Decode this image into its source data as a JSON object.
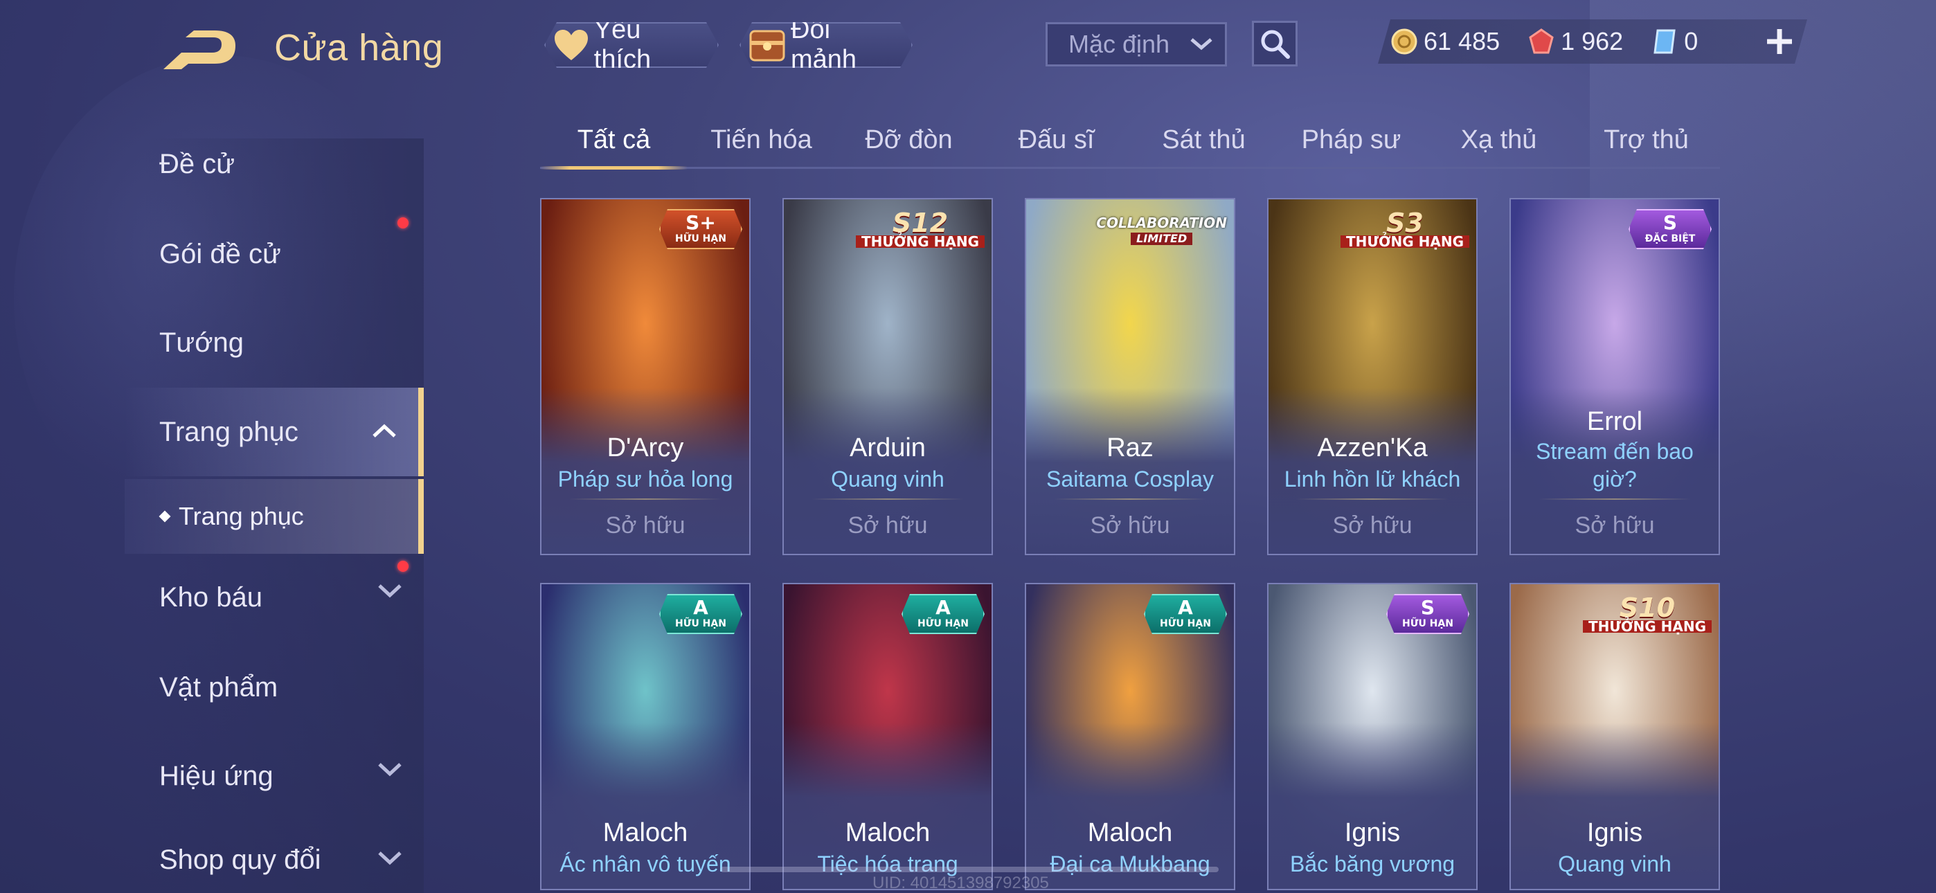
{
  "header": {
    "title": "Cửa hàng",
    "favorites_label": "Yêu thích",
    "shards_label": "Đổi mảnh",
    "sort_value": "Mặc định",
    "currencies": [
      {
        "icon": "gold-coin-icon",
        "value": "61 485"
      },
      {
        "icon": "red-gem-icon",
        "value": "1 962"
      },
      {
        "icon": "blue-voucher-icon",
        "value": "0"
      }
    ]
  },
  "sidebar": {
    "items": [
      {
        "label": "Đề cử"
      },
      {
        "label": "Gói đề cử"
      },
      {
        "label": "Tướng"
      },
      {
        "label": "Trang phục"
      },
      {
        "label": "Kho báu"
      },
      {
        "label": "Vật phẩm"
      },
      {
        "label": "Hiệu ứng"
      },
      {
        "label": "Shop quy đổi"
      }
    ],
    "sub_item": "Trang phục"
  },
  "tabs": [
    "Tất cả",
    "Tiến hóa",
    "Đỡ đòn",
    "Đấu sĩ",
    "Sát thủ",
    "Pháp sư",
    "Xạ thủ",
    "Trợ thủ"
  ],
  "cards": [
    {
      "hero": "D'Arcy",
      "skin": "Pháp sư hỏa long",
      "status": "Sở hữu",
      "badge_tier": "S+",
      "badge_sub": "HỮU HẠN",
      "art_a": "#f08a3a",
      "art_b": "#6b1e12"
    },
    {
      "hero": "Arduin",
      "skin": "Quang vinh",
      "status": "Sở hữu",
      "badge_tier": "S12",
      "badge_sub": "THƯỞNG HẠNG",
      "art_a": "#9fb3c8",
      "art_b": "#3a3b48"
    },
    {
      "hero": "Raz",
      "skin": "Saitama Cosplay",
      "status": "Sở hữu",
      "badge_tier": "COLLABORATION",
      "badge_sub": "LIMITED",
      "art_a": "#f2d64c",
      "art_b": "#8fa9c6"
    },
    {
      "hero": "Azzen'Ka",
      "skin": "Linh hồn lữ khách",
      "status": "Sở hữu",
      "badge_tier": "S3",
      "badge_sub": "THƯỞNG HẠNG",
      "art_a": "#c9a24a",
      "art_b": "#4b3416"
    },
    {
      "hero": "Errol",
      "skin": "Stream đến bao giờ?",
      "status": "Sở hữu",
      "badge_tier": "S",
      "badge_sub": "ĐẶC BIỆT",
      "art_a": "#c7a8e8",
      "art_b": "#3b3b8a"
    },
    {
      "hero": "Maloch",
      "skin": "Ác nhân vô tuyến",
      "status": "",
      "badge_tier": "A",
      "badge_sub": "HỮU HẠN",
      "art_a": "#6fc3c9",
      "art_b": "#2b2e6e"
    },
    {
      "hero": "Maloch",
      "skin": "Tiệc hóa trang",
      "status": "",
      "badge_tier": "A",
      "badge_sub": "HỮU HẠN",
      "art_a": "#c0364a",
      "art_b": "#3a1430"
    },
    {
      "hero": "Maloch",
      "skin": "Đại ca Mukbang",
      "status": "",
      "badge_tier": "A",
      "badge_sub": "HỮU HẠN",
      "art_a": "#f0a040",
      "art_b": "#33305e"
    },
    {
      "hero": "Ignis",
      "skin": "Bắc băng vương",
      "status": "",
      "badge_tier": "S",
      "badge_sub": "HỮU HẠN",
      "art_a": "#dfe6ef",
      "art_b": "#4b5872"
    },
    {
      "hero": "Ignis",
      "skin": "Quang vinh",
      "status": "",
      "badge_tier": "S10",
      "badge_sub": "THƯỞNG HẠNG",
      "art_a": "#f1e6d8",
      "art_b": "#9b6a4a"
    }
  ],
  "footer": {
    "uid": "UID: 401451398792305"
  }
}
